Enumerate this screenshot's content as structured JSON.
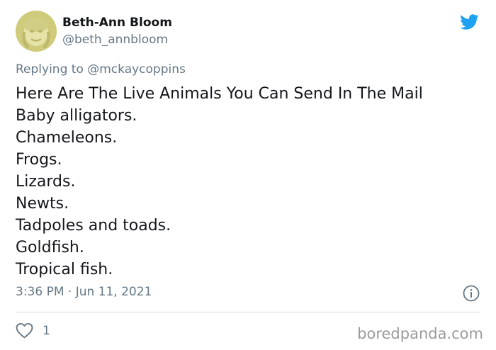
{
  "tweet": {
    "author_name": "Beth-Ann Bloom",
    "author_handle": "@beth_annbloom",
    "reply_prefix": "Replying to",
    "reply_to": "@mckaycoppins",
    "lines": [
      "Here Are The Live Animals You Can Send In The Mail",
      "Baby alligators.",
      "Chameleons.",
      "Frogs.",
      "Lizards.",
      "Newts.",
      "Tadpoles and toads.",
      "Goldfish.",
      "Tropical fish."
    ],
    "timestamp": "3:36 PM · Jun 11, 2021",
    "like_count": "1"
  },
  "watermark": "boredpanda.com",
  "colors": {
    "twitter_blue": "#1da1f2",
    "text_primary": "#14171a",
    "text_secondary": "#657786",
    "divider": "#d6dde3"
  },
  "icons": {
    "brand": "twitter-bird-icon",
    "info": "info-icon",
    "like": "heart-icon"
  }
}
